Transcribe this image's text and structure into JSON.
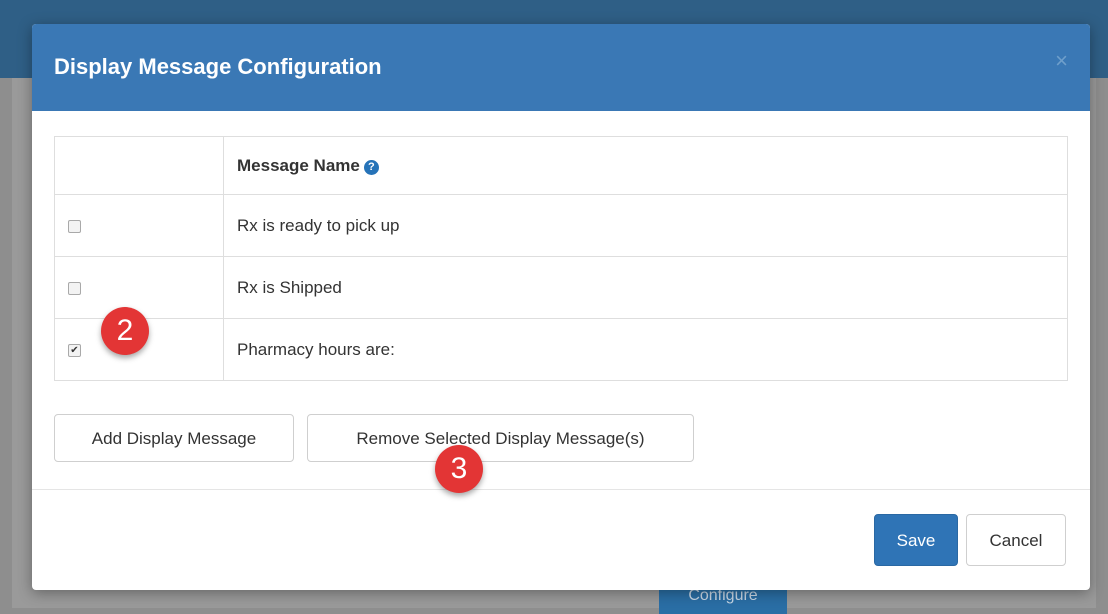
{
  "dialog": {
    "title": "Display Message Configuration",
    "close": "×"
  },
  "table": {
    "header": {
      "message_name": "Message Name",
      "help_icon": "?"
    },
    "rows": [
      {
        "label": "Rx is ready to pick up",
        "checked": false
      },
      {
        "label": "Rx is Shipped",
        "checked": false
      },
      {
        "label": "Pharmacy hours are:",
        "checked": true
      }
    ]
  },
  "buttons": {
    "add": "Add Display Message",
    "remove": "Remove Selected Display Message(s)",
    "save": "Save",
    "cancel": "Cancel"
  },
  "annotations": {
    "step2": "2",
    "step3": "3"
  },
  "background": {
    "button_label": "Configure"
  },
  "colors": {
    "header_bg": "#3a78b5",
    "primary_button": "#2f74b6",
    "badge_red": "#e33535"
  },
  "icons": {
    "close": "close-icon",
    "help": "question-circle-icon",
    "checkmark": "check-icon"
  }
}
